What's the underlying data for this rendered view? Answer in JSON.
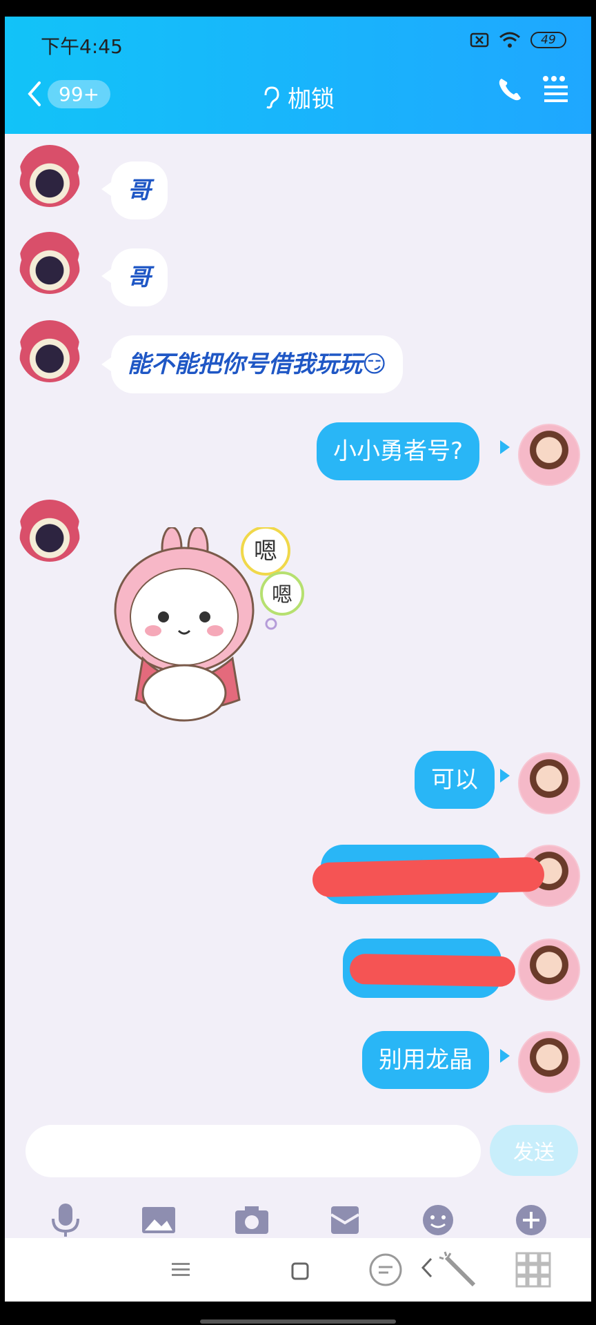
{
  "status_bar": {
    "time": "下午4:45",
    "battery": "49"
  },
  "header": {
    "back_badge": "99+",
    "title": "枷锁"
  },
  "messages": [
    {
      "side": "left",
      "text": "哥"
    },
    {
      "side": "left",
      "text": "哥"
    },
    {
      "side": "left",
      "text": "能不能把你号借我玩玩😏"
    },
    {
      "side": "right",
      "text": "小小勇者号?"
    },
    {
      "side": "left",
      "type": "sticker",
      "text": "嗯"
    },
    {
      "side": "right",
      "text": "可以"
    },
    {
      "side": "right",
      "text": "",
      "redacted": true
    },
    {
      "side": "right",
      "text": "",
      "redacted": true
    },
    {
      "side": "right",
      "text": "别用龙晶"
    }
  ],
  "input": {
    "send_label": "发送"
  },
  "toolbar": [
    "mic-icon",
    "image-icon",
    "camera-icon",
    "wallet-icon",
    "emoji-icon",
    "plus-icon"
  ],
  "colors": {
    "header": "#1fa7ff",
    "bubble_right": "#29b6f6",
    "bubble_left_text": "#1f57c5",
    "redact": "#f55454"
  }
}
